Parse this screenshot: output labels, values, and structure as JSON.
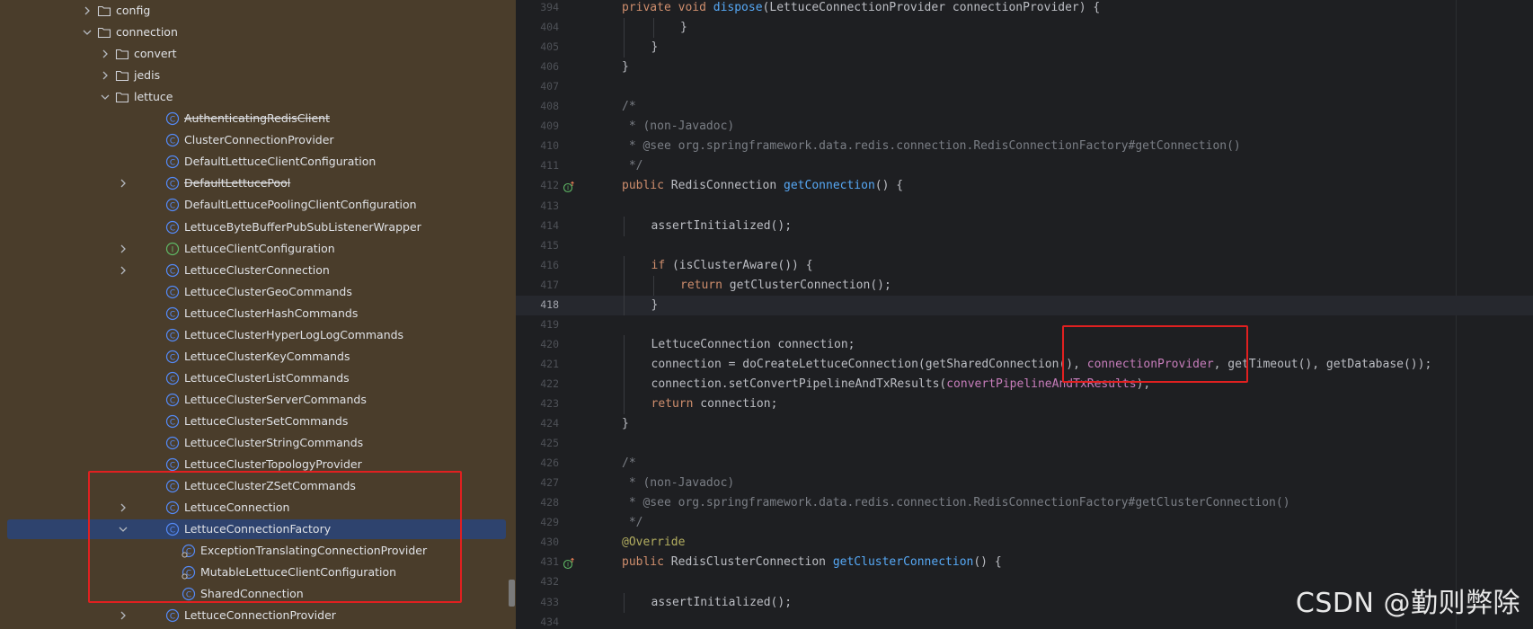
{
  "tree": {
    "rows": [
      {
        "label": "config",
        "icon": "folder",
        "chevron": "right",
        "level": 0
      },
      {
        "label": "connection",
        "icon": "folder",
        "chevron": "down",
        "level": 0
      },
      {
        "label": "convert",
        "icon": "folder",
        "chevron": "right",
        "level": 1
      },
      {
        "label": "jedis",
        "icon": "folder",
        "chevron": "right",
        "level": 1
      },
      {
        "label": "lettuce",
        "icon": "folder",
        "chevron": "down",
        "level": 1
      },
      {
        "label": "AuthenticatingRedisClient",
        "icon": "class",
        "chevron": "none",
        "level": 2,
        "strike": true
      },
      {
        "label": "ClusterConnectionProvider",
        "icon": "class",
        "chevron": "none",
        "level": 2
      },
      {
        "label": "DefaultLettuceClientConfiguration",
        "icon": "class",
        "chevron": "none",
        "level": 2
      },
      {
        "label": "DefaultLettucePool",
        "icon": "class",
        "chevron": "right",
        "level": 2,
        "strike": true
      },
      {
        "label": "DefaultLettucePoolingClientConfiguration",
        "icon": "class",
        "chevron": "none",
        "level": 2
      },
      {
        "label": "LettuceByteBufferPubSubListenerWrapper",
        "icon": "class",
        "chevron": "none",
        "level": 2
      },
      {
        "label": "LettuceClientConfiguration",
        "icon": "interface",
        "chevron": "right",
        "level": 2
      },
      {
        "label": "LettuceClusterConnection",
        "icon": "class",
        "chevron": "right",
        "level": 2
      },
      {
        "label": "LettuceClusterGeoCommands",
        "icon": "class",
        "chevron": "none",
        "level": 2
      },
      {
        "label": "LettuceClusterHashCommands",
        "icon": "class",
        "chevron": "none",
        "level": 2
      },
      {
        "label": "LettuceClusterHyperLogLogCommands",
        "icon": "class",
        "chevron": "none",
        "level": 2
      },
      {
        "label": "LettuceClusterKeyCommands",
        "icon": "class",
        "chevron": "none",
        "level": 2
      },
      {
        "label": "LettuceClusterListCommands",
        "icon": "class",
        "chevron": "none",
        "level": 2
      },
      {
        "label": "LettuceClusterServerCommands",
        "icon": "class",
        "chevron": "none",
        "level": 2
      },
      {
        "label": "LettuceClusterSetCommands",
        "icon": "class",
        "chevron": "none",
        "level": 2
      },
      {
        "label": "LettuceClusterStringCommands",
        "icon": "class",
        "chevron": "none",
        "level": 2
      },
      {
        "label": "LettuceClusterTopologyProvider",
        "icon": "class",
        "chevron": "none",
        "level": 2
      },
      {
        "label": "LettuceClusterZSetCommands",
        "icon": "class",
        "chevron": "none",
        "level": 2
      },
      {
        "label": "LettuceConnection",
        "icon": "class",
        "chevron": "right",
        "level": 2
      },
      {
        "label": "LettuceConnectionFactory",
        "icon": "class",
        "chevron": "down",
        "level": 2,
        "selected": true
      },
      {
        "label": "ExceptionTranslatingConnectionProvider",
        "icon": "inner-class",
        "chevron": "none",
        "level": 3
      },
      {
        "label": "MutableLettuceClientConfiguration",
        "icon": "inner-class",
        "chevron": "none",
        "level": 3
      },
      {
        "label": "SharedConnection",
        "icon": "class",
        "chevron": "none",
        "level": 3
      },
      {
        "label": "LettuceConnectionProvider",
        "icon": "class",
        "chevron": "right",
        "level": 2
      }
    ]
  },
  "editor": {
    "current_line": "418",
    "lines": [
      {
        "n": "394",
        "segs": [
          [
            "kw",
            "private void "
          ],
          [
            "fn",
            "dispose"
          ],
          [
            "",
            "(LettuceConnectionProvider connectionProvider) {"
          ]
        ],
        "indent": 1
      },
      {
        "n": "404",
        "segs": [
          [
            "",
            "}"
          ]
        ],
        "indent": 3
      },
      {
        "n": "405",
        "segs": [
          [
            "",
            "}"
          ]
        ],
        "indent": 2
      },
      {
        "n": "406",
        "segs": [
          [
            "",
            "}"
          ]
        ],
        "indent": 1
      },
      {
        "n": "407",
        "segs": [],
        "indent": 0
      },
      {
        "n": "408",
        "segs": [
          [
            "cm",
            "/*"
          ]
        ],
        "indent": 1
      },
      {
        "n": "409",
        "segs": [
          [
            "cm",
            " * (non-Javadoc)"
          ]
        ],
        "indent": 1
      },
      {
        "n": "410",
        "segs": [
          [
            "cm",
            " * @see org.springframework.data.redis.connection.RedisConnectionFactory#getConnection()"
          ]
        ],
        "indent": 1
      },
      {
        "n": "411",
        "segs": [
          [
            "cm",
            " */"
          ]
        ],
        "indent": 1
      },
      {
        "n": "412",
        "segs": [
          [
            "kw",
            "public "
          ],
          [
            "",
            "RedisConnection "
          ],
          [
            "fn",
            "getConnection"
          ],
          [
            "",
            "() {"
          ]
        ],
        "indent": 1,
        "gutter": "implements-icon"
      },
      {
        "n": "413",
        "segs": [],
        "indent": 0
      },
      {
        "n": "414",
        "segs": [
          [
            "",
            "assertInitialized();"
          ]
        ],
        "indent": 2
      },
      {
        "n": "415",
        "segs": [],
        "indent": 0
      },
      {
        "n": "416",
        "segs": [
          [
            "kw",
            "if "
          ],
          [
            "",
            "(isClusterAware()) {"
          ]
        ],
        "indent": 2
      },
      {
        "n": "417",
        "segs": [
          [
            "kw",
            "return "
          ],
          [
            "",
            "getClusterConnection();"
          ]
        ],
        "indent": 3
      },
      {
        "n": "418",
        "segs": [
          [
            "",
            "}"
          ]
        ],
        "indent": 2
      },
      {
        "n": "419",
        "segs": [],
        "indent": 0
      },
      {
        "n": "420",
        "segs": [
          [
            "",
            "LettuceConnection connection;"
          ]
        ],
        "indent": 2
      },
      {
        "n": "421",
        "segs": [
          [
            "",
            "connection = doCreateLettuceConnection(getSharedConnection(), "
          ],
          [
            "fld",
            "connectionProvider"
          ],
          [
            "",
            ", getTimeout(), getDatabase());"
          ]
        ],
        "indent": 2
      },
      {
        "n": "422",
        "segs": [
          [
            "",
            "connection.setConvertPipelineAndTxResults("
          ],
          [
            "fld",
            "convertPipelineAndTxResults"
          ],
          [
            "",
            ");"
          ]
        ],
        "indent": 2
      },
      {
        "n": "423",
        "segs": [
          [
            "kw",
            "return "
          ],
          [
            "",
            "connection;"
          ]
        ],
        "indent": 2
      },
      {
        "n": "424",
        "segs": [
          [
            "",
            "}"
          ]
        ],
        "indent": 1
      },
      {
        "n": "425",
        "segs": [],
        "indent": 0
      },
      {
        "n": "426",
        "segs": [
          [
            "cm",
            "/*"
          ]
        ],
        "indent": 1
      },
      {
        "n": "427",
        "segs": [
          [
            "cm",
            " * (non-Javadoc)"
          ]
        ],
        "indent": 1
      },
      {
        "n": "428",
        "segs": [
          [
            "cm",
            " * @see org.springframework.data.redis.connection.RedisConnectionFactory#getClusterConnection()"
          ]
        ],
        "indent": 1
      },
      {
        "n": "429",
        "segs": [
          [
            "cm",
            " */"
          ]
        ],
        "indent": 1
      },
      {
        "n": "430",
        "segs": [
          [
            "an",
            "@Override"
          ]
        ],
        "indent": 1
      },
      {
        "n": "431",
        "segs": [
          [
            "kw",
            "public "
          ],
          [
            "",
            "RedisClusterConnection "
          ],
          [
            "fn",
            "getClusterConnection"
          ],
          [
            "",
            "() {"
          ]
        ],
        "indent": 1,
        "gutter": "implements-icon"
      },
      {
        "n": "432",
        "segs": [],
        "indent": 0
      },
      {
        "n": "433",
        "segs": [
          [
            "",
            "assertInitialized();"
          ]
        ],
        "indent": 2
      },
      {
        "n": "434",
        "segs": [],
        "indent": 0
      }
    ]
  },
  "watermark": "CSDN @勤则弊除",
  "colors": {
    "tree_bg": "#4a3d2b",
    "tree_selection": "#2e436e",
    "editor_bg": "#1e1f22",
    "keyword": "#cf8e6d",
    "method": "#56a8f5",
    "comment": "#7a7e85",
    "field": "#c77dbb",
    "annotation": "#b3ae60",
    "highlight_box": "#e02020"
  }
}
